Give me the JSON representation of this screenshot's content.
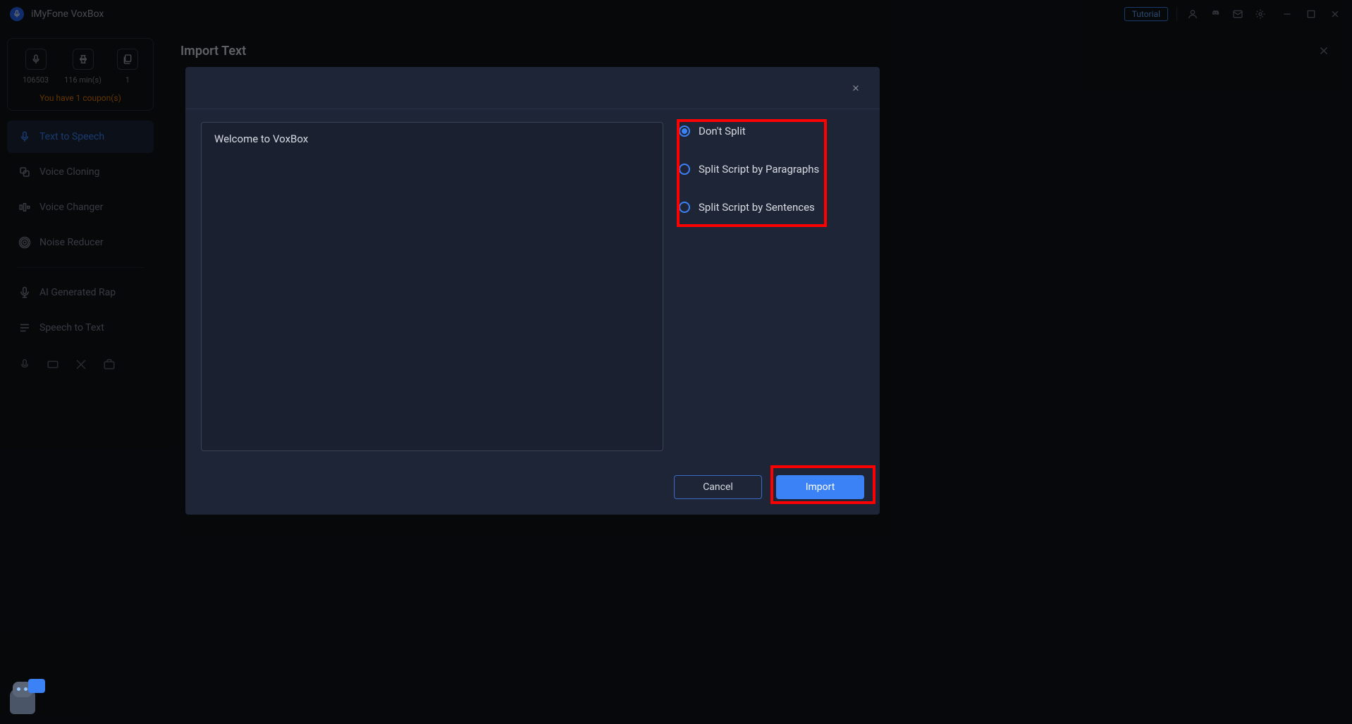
{
  "titlebar": {
    "app_name": "iMyFone VoxBox",
    "tutorial_label": "Tutorial"
  },
  "sidebar": {
    "stats": {
      "chars": "106503",
      "minutes": "116 min(s)",
      "files": "1"
    },
    "coupon_text": "You have 1 coupon(s)",
    "nav": [
      {
        "label": "Text to Speech",
        "active": true
      },
      {
        "label": "Voice Cloning",
        "active": false
      },
      {
        "label": "Voice Changer",
        "active": false
      },
      {
        "label": "Noise Reducer",
        "active": false
      },
      {
        "label": "AI Generated Rap",
        "active": false
      },
      {
        "label": "Speech to Text",
        "active": false
      }
    ]
  },
  "content": {
    "title": "Import Text"
  },
  "modal": {
    "text_value": "Welcome to VoxBox",
    "options": [
      {
        "label": "Don't Split",
        "checked": true
      },
      {
        "label": "Split Script by Paragraphs",
        "checked": false
      },
      {
        "label": "Split Script by Sentences",
        "checked": false
      }
    ],
    "cancel_label": "Cancel",
    "import_label": "Import"
  }
}
